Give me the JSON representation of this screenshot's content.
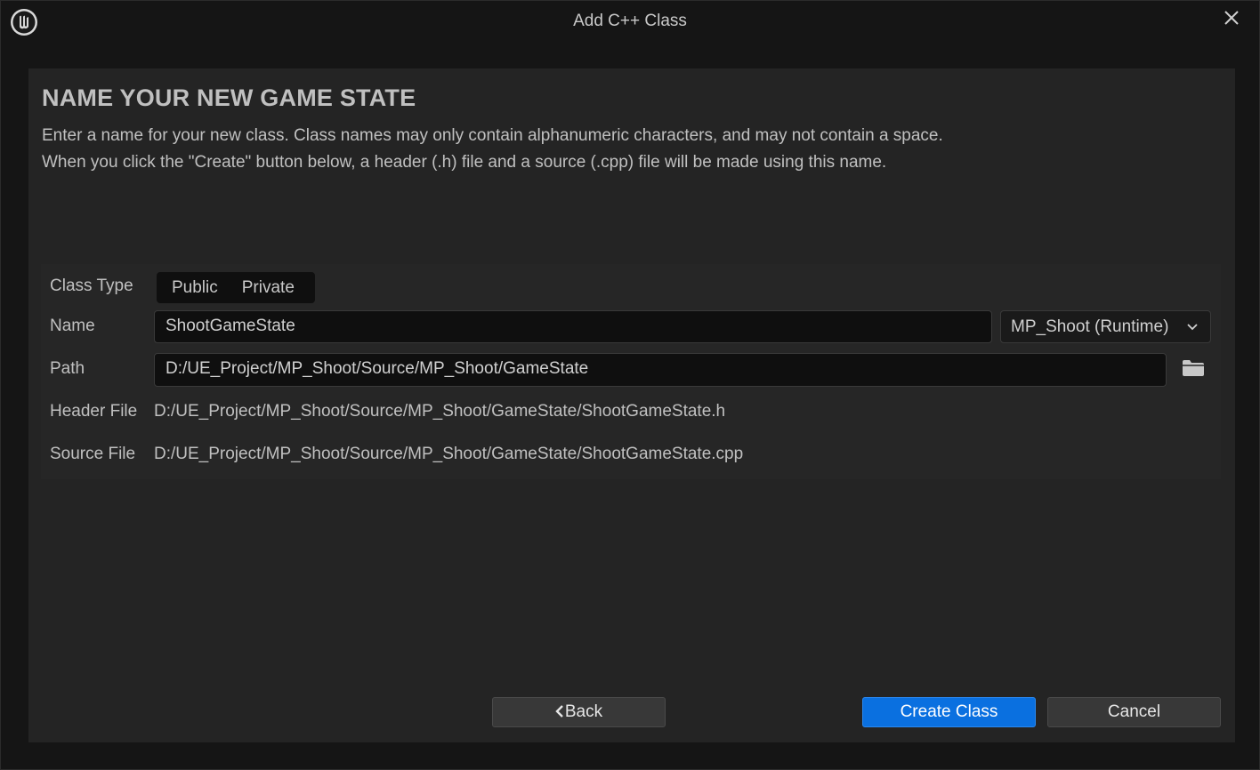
{
  "window": {
    "title": "Add C++ Class"
  },
  "header": {
    "heading": "NAME YOUR NEW GAME STATE",
    "description_line1": "Enter a name for your new class. Class names may only contain alphanumeric characters, and may not contain a space.",
    "description_line2": "When you click the \"Create\" button below, a header (.h) file and a source (.cpp) file will be made using this name."
  },
  "form": {
    "class_type_label": "Class Type",
    "class_type_options": [
      "Public",
      "Private"
    ],
    "name_label": "Name",
    "name_value": "ShootGameState",
    "module_value": "MP_Shoot (Runtime)",
    "path_label": "Path",
    "path_value": "D:/UE_Project/MP_Shoot/Source/MP_Shoot/GameState",
    "header_file_label": "Header File",
    "header_file_value": "D:/UE_Project/MP_Shoot/Source/MP_Shoot/GameState/ShootGameState.h",
    "source_file_label": "Source File",
    "source_file_value": "D:/UE_Project/MP_Shoot/Source/MP_Shoot/GameState/ShootGameState.cpp"
  },
  "buttons": {
    "back_label": "Back",
    "create_label": "Create Class",
    "cancel_label": "Cancel"
  },
  "icons": {
    "logo": "unreal-engine-logo",
    "close": "close-icon",
    "folder": "folder-icon",
    "chevron": "chevron-down-icon",
    "back_arrow": "chevron-left-icon"
  },
  "colors": {
    "accent": "#0a70e0",
    "background": "#151515",
    "panel": "#242424"
  }
}
